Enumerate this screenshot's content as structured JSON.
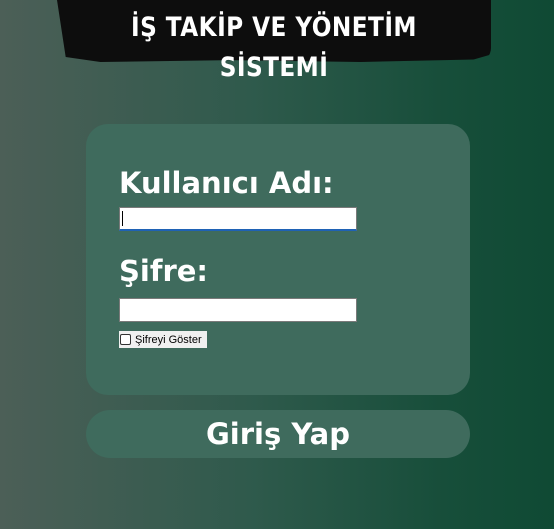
{
  "app": {
    "title": "İŞ TAKİP VE YÖNETİM SİSTEMİ"
  },
  "login_form": {
    "username_label": "Kullanıcı Adı:",
    "username_value": "",
    "password_label": "Şifre:",
    "password_value": "",
    "show_password_label": "Şifreyi Göster",
    "show_password_checked": false,
    "submit_label": "Giriş Yap"
  },
  "colors": {
    "panel": "#3f6b5d",
    "banner": "#0d0d0d",
    "text": "#ffffff",
    "focus_accent": "#1f62b5"
  }
}
